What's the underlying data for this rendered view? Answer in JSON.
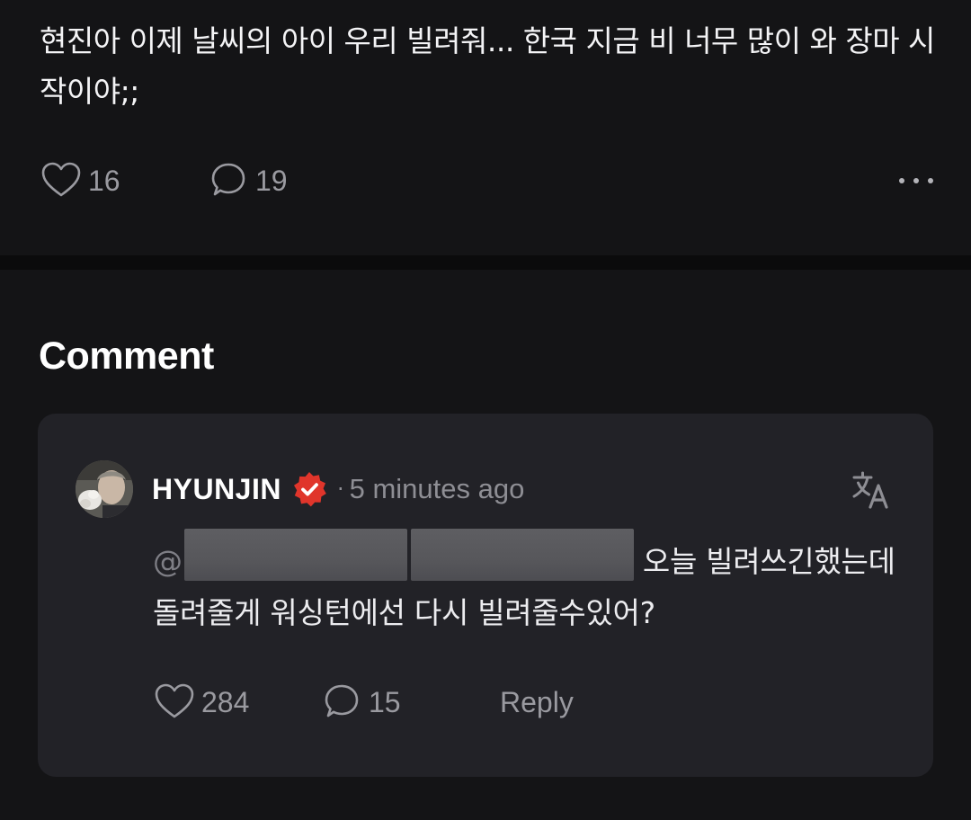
{
  "post": {
    "text": "현진아 이제 날씨의 아이 우리 빌려줘... 한국 지금 비 너무 많이 와 장마 시작이야;;",
    "likes": "16",
    "comments": "19"
  },
  "comments_section": {
    "title": "Comment"
  },
  "comment": {
    "username": "HYUNJIN",
    "timestamp": "5 minutes ago",
    "mention_prefix": "@",
    "body_tail_hidden": "",
    "body": "오늘 빌려쓰긴했는데 돌려줄게 워싱턴에선 다시 빌려줄수있어?",
    "likes": "284",
    "replies": "15",
    "reply_label": "Reply"
  },
  "colors": {
    "background": "#141416",
    "card": "#222227",
    "muted_text": "#9a9aa0",
    "verified_badge": "#e0352b"
  },
  "icons": {
    "like": "heart-outline-icon",
    "comment": "speech-bubble-icon",
    "more": "more-horizontal-icon",
    "verified": "verified-badge-icon",
    "translate": "translate-icon"
  }
}
